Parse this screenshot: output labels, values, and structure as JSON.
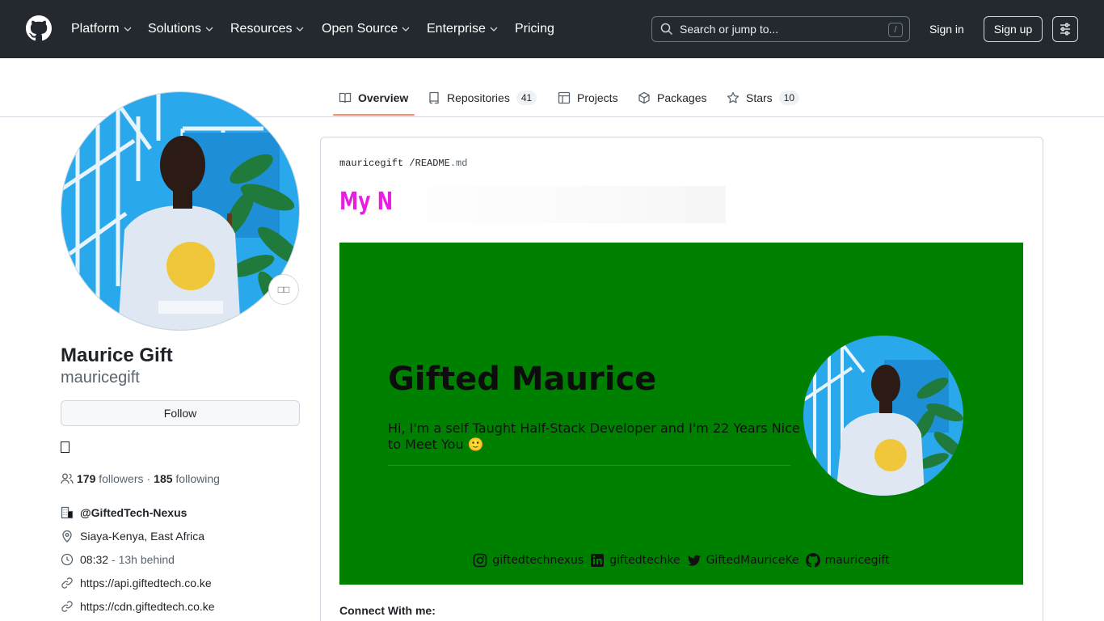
{
  "header": {
    "nav": [
      {
        "label": "Platform",
        "has_menu": true
      },
      {
        "label": "Solutions",
        "has_menu": true
      },
      {
        "label": "Resources",
        "has_menu": true
      },
      {
        "label": "Open Source",
        "has_menu": true
      },
      {
        "label": "Enterprise",
        "has_menu": true
      },
      {
        "label": "Pricing",
        "has_menu": false
      }
    ],
    "search_placeholder": "Search or jump to...",
    "search_shortcut": "/",
    "sign_in": "Sign in",
    "sign_up": "Sign up"
  },
  "tabs": [
    {
      "label": "Overview",
      "icon": "book-icon",
      "active": true
    },
    {
      "label": "Repositories",
      "icon": "repo-icon",
      "count": "41"
    },
    {
      "label": "Projects",
      "icon": "table-icon"
    },
    {
      "label": "Packages",
      "icon": "package-icon"
    },
    {
      "label": "Stars",
      "icon": "star-icon",
      "count": "10"
    }
  ],
  "profile": {
    "full_name": "Maurice Gift",
    "username": "mauricegift",
    "follow_button": "Follow",
    "emoji_button": "□□",
    "followers_count": "179",
    "followers_label": "followers",
    "separator": "·",
    "following_count": "185",
    "following_label": "following",
    "organization": "@GiftedTech-Nexus",
    "location": "Siaya-Kenya, East Africa",
    "local_time": "08:32",
    "time_offset": "- 13h behind",
    "links": [
      "https://api.giftedtech.co.ke",
      "https://cdn.giftedtech.co.ke"
    ]
  },
  "readme": {
    "owner": "mauricegift",
    "path_sep": "/",
    "file_name": "README",
    "file_ext": ".md",
    "typing_text": "My N",
    "banner": {
      "name": "Gifted Maurice",
      "bio": "Hi, I'm a self Taught Half-Stack Developer and I'm 22 Years Nice to Meet You 🙂",
      "socials": [
        {
          "icon": "instagram-icon",
          "handle": "giftedtechnexus"
        },
        {
          "icon": "linkedin-icon",
          "handle": "giftedtechke"
        },
        {
          "icon": "twitter-icon",
          "handle": "GiftedMauriceKe"
        },
        {
          "icon": "github-icon",
          "handle": "mauricegift"
        }
      ]
    },
    "connect_heading": "Connect With me:"
  },
  "colors": {
    "header_bg": "#24292f",
    "tab_underline": "#fd8c73",
    "banner_bg": "#008000",
    "typing_text": "#e91ee3"
  }
}
